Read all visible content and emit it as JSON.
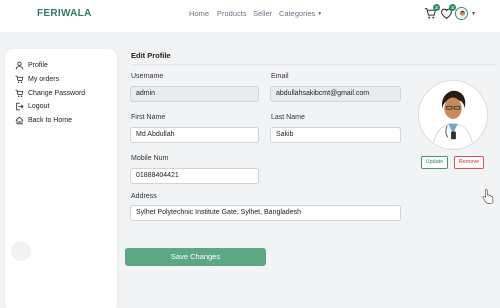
{
  "header": {
    "brand": "FERIWALA",
    "nav": [
      {
        "label": "Home"
      },
      {
        "label": "Products"
      },
      {
        "label": "Seller"
      },
      {
        "label": "Categories"
      }
    ],
    "cart_count": "2",
    "wishlist_count": "4"
  },
  "sidebar": {
    "items": [
      {
        "label": "Profile",
        "icon": "user-icon"
      },
      {
        "label": "My orders",
        "icon": "cart-icon"
      },
      {
        "label": "Change Password",
        "icon": "cart-icon"
      },
      {
        "label": "Logout",
        "icon": "logout-icon"
      },
      {
        "label": "Back to Home",
        "icon": "home-icon"
      }
    ]
  },
  "form": {
    "title": "Edit Profile",
    "username_label": "Username",
    "username_value": "admin",
    "email_label": "Email",
    "email_value": "abdullahsakibcmt@gmail.com",
    "first_name_label": "First Name",
    "first_name_value": "Md Abdullah",
    "last_name_label": "Last Name",
    "last_name_value": "Sakib",
    "mobile_label": "Mobile Num",
    "mobile_value": "01888404421",
    "address_label": "Address",
    "address_value": "Sylhet Polytechnic Institute Gate, Sylhet, Bangladesh",
    "save_label": "Save Changes"
  },
  "profile_photo": {
    "update_label": "Update",
    "remove_label": "Remove"
  },
  "colors": {
    "brand_green": "#2f7d5b",
    "save_button": "#5ba883",
    "remove_red": "#d9534f"
  }
}
